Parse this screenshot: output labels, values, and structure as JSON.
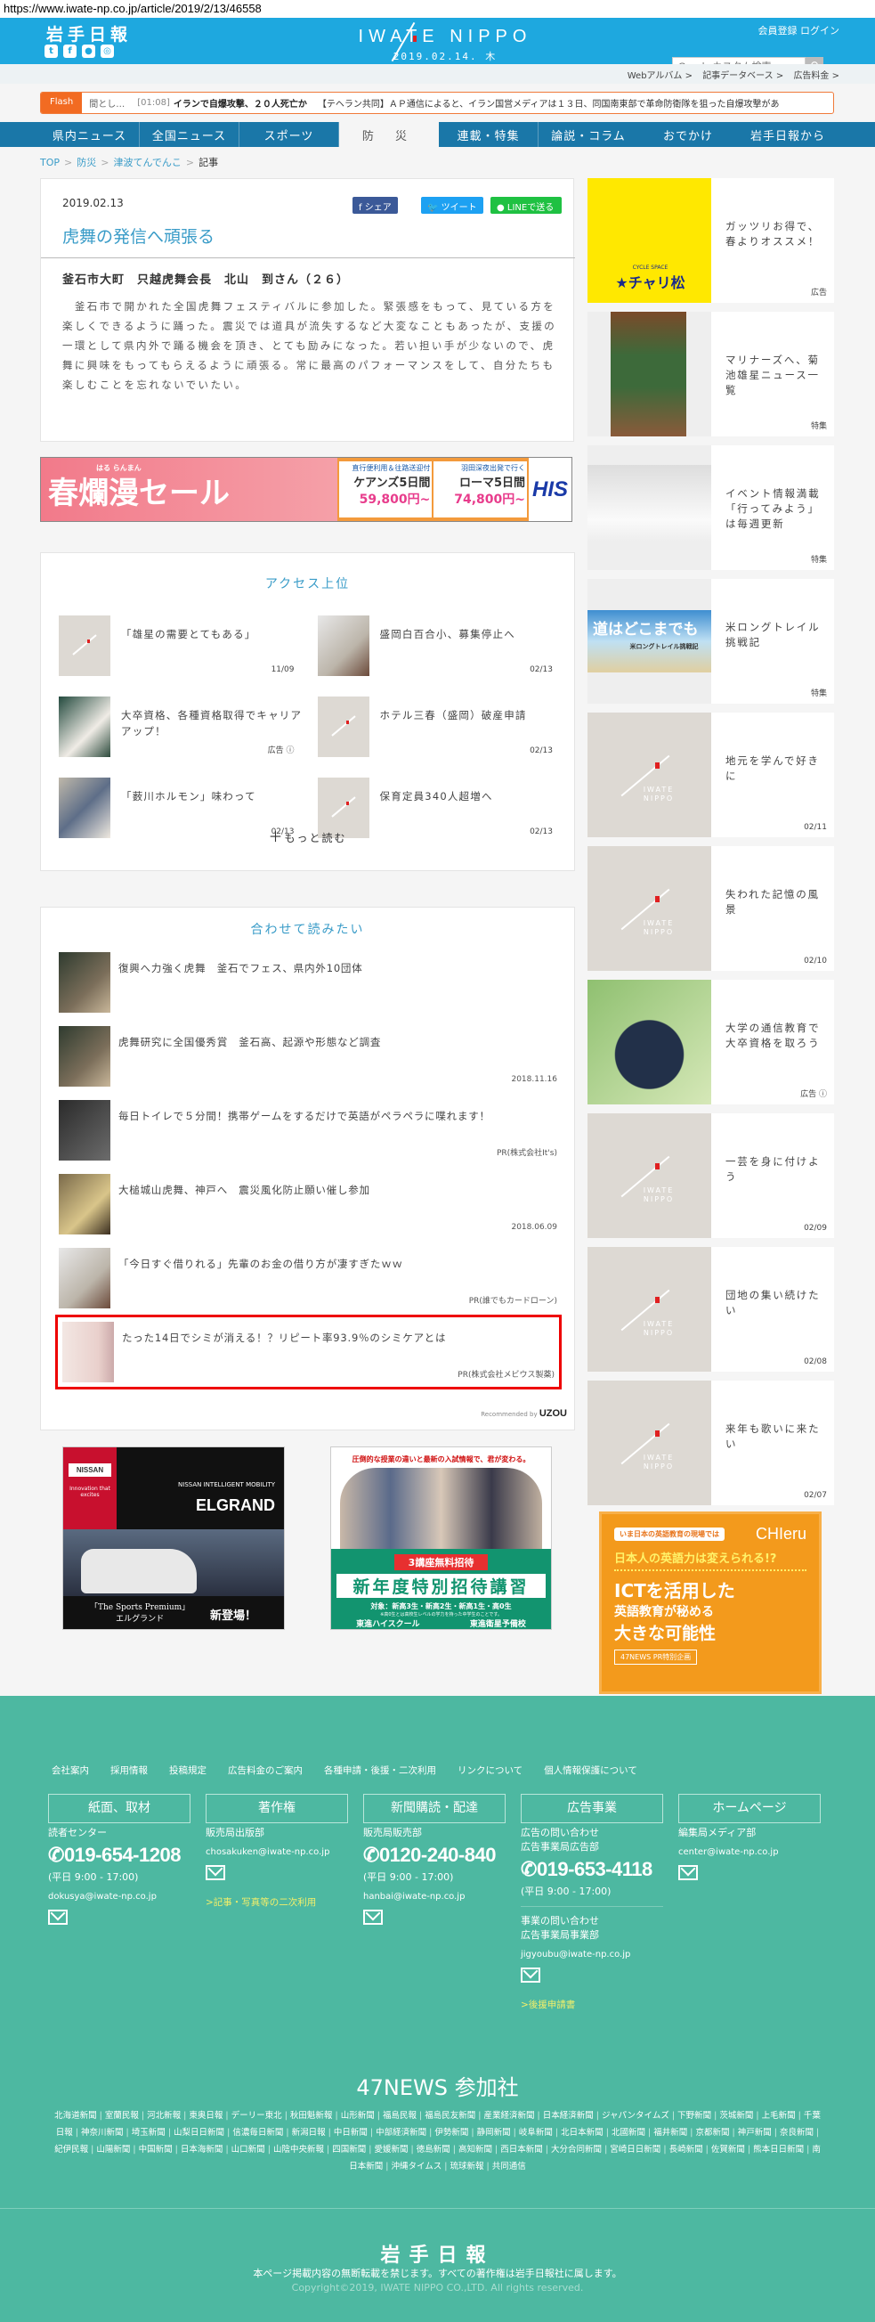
{
  "url": "https://www.iwate-np.co.jp/article/2019/2/13/46558",
  "header": {
    "logo_jp": "岩手日報",
    "brand_en": "IWATE NIPPO",
    "date": "2019.02.14. 木",
    "register": "会員登録",
    "login": "ログイン",
    "search_placeholder": "Google カスタム検索",
    "social": [
      "twitter-icon",
      "facebook-icon",
      "line-icon",
      "instagram-icon"
    ]
  },
  "subbar": [
    "Webアルバム >",
    "記事データベース >",
    "広告料金 >"
  ],
  "flash": {
    "label": "Flash",
    "prev": "間とし…",
    "time": "[01:08]",
    "headline": "イランで自爆攻撃、２０人死亡か",
    "body": "【テヘラン共同】ＡＰ通信によると、イラン国営メディアは１３日、同国南東部で革命防衛隊を狙った自爆攻撃があ"
  },
  "nav": [
    "県内ニュース",
    "全国ニュース",
    "スポーツ",
    "防 災",
    "連載・特集",
    "論説・コラム",
    "おでかけ",
    "岩手日報から"
  ],
  "breadcrumb": {
    "top": "TOP",
    "cat": "防災",
    "sub": "津波てんでんこ",
    "current": "記事",
    "sep": ">"
  },
  "article": {
    "date": "2019.02.13",
    "share": {
      "facebook": "シェア",
      "twitter": "ツイート",
      "line": "LINEで送る"
    },
    "title": "虎舞の発信へ頑張る",
    "subtitle": "釜石市大町　只越虎舞会長　北山　到さん（２６）",
    "body": "　釜石市で開かれた全国虎舞フェスティバルに参加した。緊張感をもって、見ている方を楽しくできるように踊った。震災では道具が流失するなど大変なこともあったが、支援の一環として県内外で踊る機会を頂き、とても励みになった。若い担い手が少ないので、虎舞に興味をもってもらえるように頑張る。常に最高のパフォーマンスをして、自分たちも楽しむことを忘れないでいたい。"
  },
  "ad_banner": {
    "headline": "春爛漫セール",
    "ruby": "はる らんまん",
    "offer1": {
      "note": "直行便利用＆往路送迎付",
      "dest": "ケアンズ5日間",
      "price": "59,800円~"
    },
    "offer2": {
      "note": "羽田深夜出発で行く",
      "dest": "ローマ5日間",
      "price": "74,800円~"
    },
    "brand": "HIS"
  },
  "access": {
    "title": "アクセス上位",
    "items": [
      {
        "title": "「雄星の需要とてもある」",
        "meta": "11/09",
        "thumb": "logo"
      },
      {
        "title": "盛岡白百合小、募集停止へ",
        "meta": "02/13",
        "thumb": "photo-light"
      },
      {
        "title": "大卒資格、各種資格取得でキャリアアップ！",
        "meta": "広告 ⓘ",
        "thumb": "photo-green"
      },
      {
        "title": "ホテル三春（盛岡）破産申請",
        "meta": "02/13",
        "thumb": "logo"
      },
      {
        "title": "「薮川ホルモン」味わって",
        "meta": "02/13",
        "thumb": "photo-people"
      },
      {
        "title": "保育定員340人超増へ",
        "meta": "02/13",
        "thumb": "logo"
      }
    ],
    "more": "もっと読む"
  },
  "related": {
    "title": "合わせて読みたい",
    "items": [
      {
        "title": "復興へ力強く虎舞　釜石でフェス、県内外10団体",
        "meta": "",
        "thumb": "photo-dark"
      },
      {
        "title": "虎舞研究に全国優秀賞　釜石高、起源や形態など調査",
        "meta": "2018.11.16",
        "thumb": "photo-dark"
      },
      {
        "title": "毎日トイレで５分間！携帯ゲームをするだけで英語がペラペラに喋れます！",
        "meta": "PR(株式会社It's)",
        "thumb": "photo-grey"
      },
      {
        "title": "大槌城山虎舞、神戸へ　震災風化防止願い催し参加",
        "meta": "2018.06.09",
        "thumb": "photo-warm"
      },
      {
        "title": "「今日すぐ借りれる」先輩のお金の借り方が凄すぎたｗｗ",
        "meta": "PR(誰でもカードローン)",
        "thumb": "photo-light"
      },
      {
        "title": "たった14日でシミが消える！？リピート率93.9％のシミケアとは",
        "meta": "PR(株式会社メビウス製薬)",
        "thumb": "photo-skin"
      }
    ],
    "recommended_by": "Recommended by",
    "uzou": "UZOU"
  },
  "ad_nissan": {
    "brand": "NISSAN",
    "tagline": "Innovation that excites",
    "mobility": "NISSAN INTELLIGENT MOBILITY",
    "model": "ELGRAND",
    "premium": "「The Sports Premium」",
    "model_jp": "エルグランド",
    "new": "新登場！"
  },
  "ad_toshin": {
    "top": "圧倒的な授業の違いと最新の入試情報で、君が変わる。",
    "badge": "3講座無料招待",
    "headline": "新年度特別招待講習",
    "target": "対象：新高3生・新高2生・新高1生・高0生",
    "note": "※高0生とは高校生レベルの学力を持った中学生のことです。",
    "school1": "東進ハイスクール",
    "school2": "東進衛星予備校"
  },
  "sidebar": [
    {
      "title": "ガッツリお得で、春よりオススメ！",
      "meta": "広告",
      "thumb": "yellow"
    },
    {
      "title": "マリナーズへ、菊池雄星ニュース一覧",
      "meta": "特集",
      "thumb": "baseball"
    },
    {
      "title": "イベント情報満載「行ってみよう」は毎週更新",
      "meta": "特集",
      "thumb": "snow"
    },
    {
      "title": "米ロングトレイル挑戦記",
      "meta": "特集",
      "thumb": "trail"
    },
    {
      "title": "地元を学んで好きに",
      "meta": "02/11",
      "thumb": "logo"
    },
    {
      "title": "失われた記憶の風景",
      "meta": "02/10",
      "thumb": "logo"
    },
    {
      "title": "大学の通信教育で大卒資格を取ろう",
      "meta": "広告 ⓘ",
      "thumb": "man"
    },
    {
      "title": "一芸を身に付けよう",
      "meta": "02/09",
      "thumb": "logo"
    },
    {
      "title": "団地の集い続けたい",
      "meta": "02/08",
      "thumb": "logo"
    },
    {
      "title": "来年も歌いに来たい",
      "meta": "02/07",
      "thumb": "logo"
    }
  ],
  "charimatsu": {
    "sub": "CYCLE SPACE",
    "name": "★チャリ松"
  },
  "trail_banner": {
    "title": "道はどこまでも",
    "sub": "米ロングトレイル挑戦記"
  },
  "ad_chieru": {
    "ribbon": "いま日本の英語教育の現場では",
    "brand": "CHIeru",
    "question": "日本人の英語力は変えられる!?",
    "line1": "ICTを活用した",
    "line2": "英語教育が秘める",
    "line3": "大きな可能性",
    "tag": "47NEWS PR特別企画"
  },
  "footer": {
    "links": [
      "会社案内",
      "採用情報",
      "投稿規定",
      "広告料金のご案内",
      "各種申請・後援・二次利用",
      "リンクについて",
      "個人情報保護について"
    ],
    "cols": [
      {
        "head": "紙面、取材",
        "dept": "読者センター",
        "phone": "019-654-1208",
        "hours": "(平日 9:00 - 17:00)",
        "email": "dokusya@iwate-np.co.jp"
      },
      {
        "head": "著作権",
        "dept": "販売局出版部",
        "email": "chosakuken@iwate-np.co.jp",
        "link": ">記事・写真等の二次利用"
      },
      {
        "head": "新聞購読・配達",
        "dept": "販売局販売部",
        "phone": "0120-240-840",
        "hours": "(平日 9:00 - 17:00)",
        "email": "hanbai@iwate-np.co.jp"
      },
      {
        "head": "広告事業",
        "dept": "広告の問い合わせ",
        "dept2": "広告事業局広告部",
        "phone": "019-653-4118",
        "hours": "(平日 9:00 - 17:00)",
        "dept3": "事業の問い合わせ",
        "dept4": "広告事業局事業部",
        "email": "jigyoubu@iwate-np.co.jp",
        "link": ">後援申請書"
      },
      {
        "head": "ホームページ",
        "dept": "編集局メディア部",
        "email": "center@iwate-np.co.jp"
      }
    ],
    "news_title": "47NEWS 参加社",
    "news": [
      "北海道新聞",
      "室蘭民報",
      "河北新報",
      "東奥日報",
      "デーリー東北",
      "秋田魁新報",
      "山形新聞",
      "福島民報",
      "福島民友新聞",
      "産業経済新聞",
      "日本経済新聞",
      "ジャパンタイムズ",
      "下野新聞",
      "茨城新聞",
      "上毛新聞",
      "千葉日報",
      "神奈川新聞",
      "埼玉新聞",
      "山梨日日新聞",
      "信濃毎日新聞",
      "新潟日報",
      "中日新聞",
      "中部経済新聞",
      "伊勢新聞",
      "静岡新聞",
      "岐阜新聞",
      "北日本新聞",
      "北國新聞",
      "福井新聞",
      "京都新聞",
      "神戸新聞",
      "奈良新聞",
      "紀伊民報",
      "山陽新聞",
      "中国新聞",
      "日本海新聞",
      "山口新聞",
      "山陰中央新報",
      "四国新聞",
      "愛媛新聞",
      "徳島新聞",
      "高知新聞",
      "西日本新聞",
      "大分合同新聞",
      "宮崎日日新聞",
      "長崎新聞",
      "佐賀新聞",
      "熊本日日新聞",
      "南日本新聞",
      "沖縄タイムス",
      "琉球新報",
      "共同通信"
    ],
    "logo": "岩手日報",
    "notice": "本ページ掲載内容の無断転載を禁じます。すべての著作権は岩手日報社に属します。",
    "copyright": "Copyright©2019, IWATE NIPPO CO.,LTD. All rights reserved."
  }
}
